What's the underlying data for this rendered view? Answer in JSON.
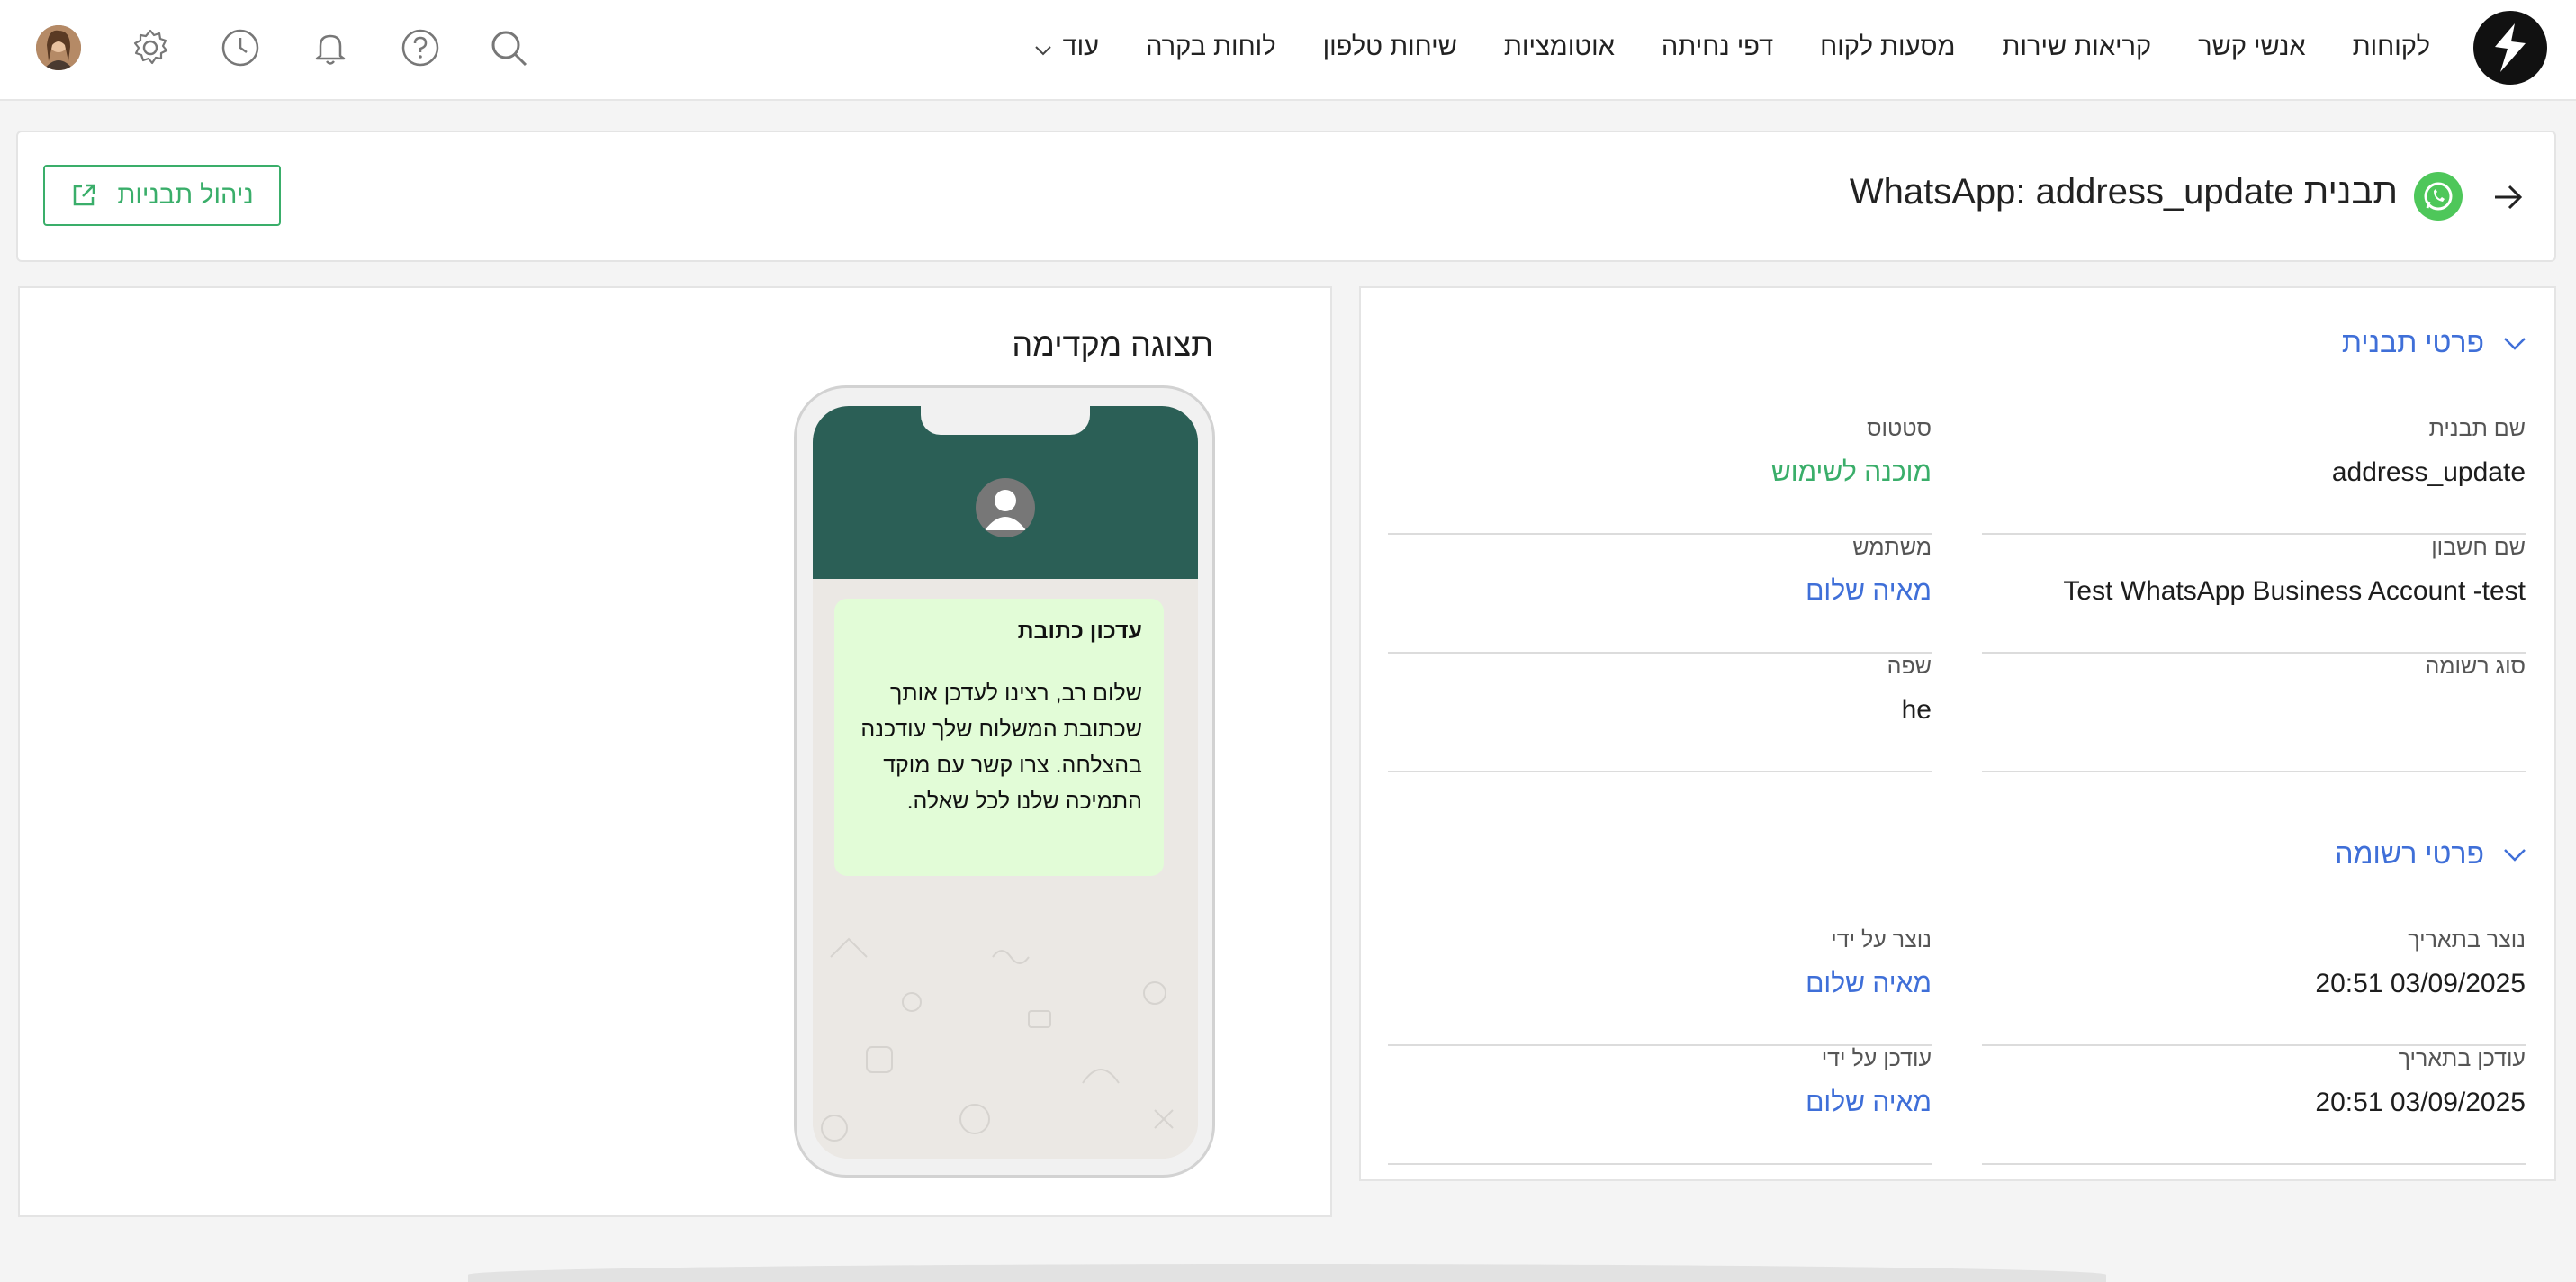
{
  "nav": {
    "items": [
      "לקוחות",
      "אנשי קשר",
      "קריאות שירות",
      "מסעות לקוח",
      "דפי נחיתה",
      "אוטומציות",
      "שיחות טלפון",
      "לוחות בקרה"
    ],
    "more_label": "עוד"
  },
  "header": {
    "title": "תבנית WhatsApp: address_update",
    "manage_button": "ניהול תבניות"
  },
  "details": {
    "section_template": "פרטי תבנית",
    "fields": {
      "template_name": {
        "label": "שם תבנית",
        "value": "address_update"
      },
      "status": {
        "label": "סטטוס",
        "value": "מוכנה לשימוש"
      },
      "account_name": {
        "label": "שם חשבון",
        "value": "Test WhatsApp Business Account -test"
      },
      "user": {
        "label": "משתמש",
        "value": "מאיה שלום"
      },
      "record_type": {
        "label": "סוג רשומה",
        "value": ""
      },
      "language": {
        "label": "שפה",
        "value": "he"
      }
    },
    "section_record": "פרטי רשומה",
    "record": {
      "created_at": {
        "label": "נוצר בתאריך",
        "value": "03/09/2025 20:51"
      },
      "created_by": {
        "label": "נוצר על ידי",
        "value": "מאיה שלום"
      },
      "updated_at": {
        "label": "עודכן בתאריך",
        "value": "03/09/2025 20:51"
      },
      "updated_by": {
        "label": "עודכן על ידי",
        "value": "מאיה שלום"
      }
    }
  },
  "preview": {
    "title": "תצוגה מקדימה",
    "message_title": "עדכון כתובת",
    "message_body": "שלום רב, רצינו לעדכן אותך שכתובת המשלוח שלך עודכנה בהצלחה. צרו קשר עם מוקד התמיכה שלנו לכל שאלה."
  },
  "colors": {
    "accent_blue": "#3f6fd8",
    "accent_green": "#3aae6a",
    "whatsapp_header": "#2b5f56",
    "bubble": "#e2fcd7"
  }
}
